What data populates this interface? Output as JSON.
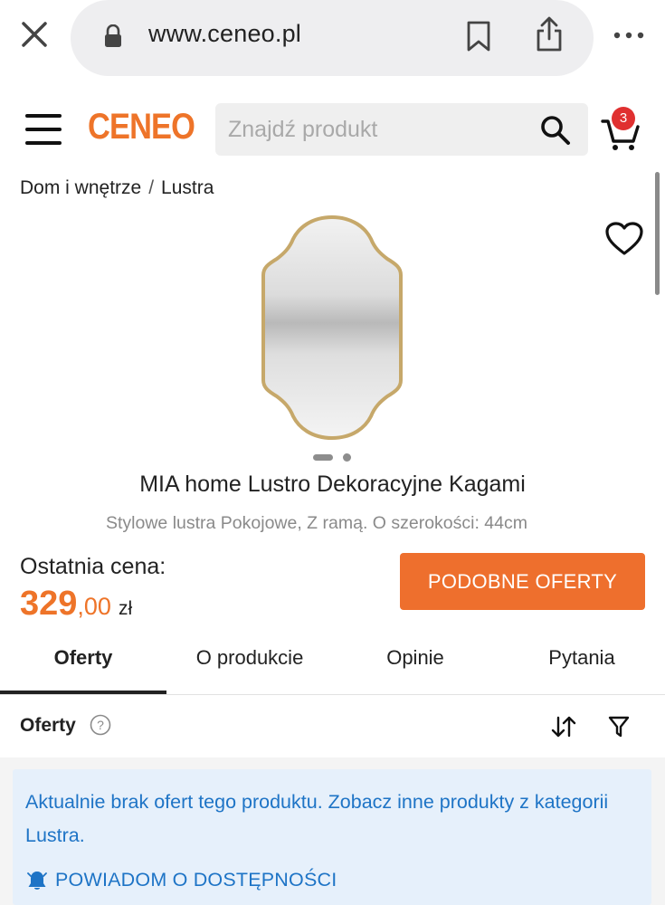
{
  "browser": {
    "url": "www.ceneo.pl",
    "icons": [
      "close-icon",
      "lock-icon",
      "bookmark-icon",
      "share-icon",
      "more-icon"
    ]
  },
  "header": {
    "logo_text": "CENEO",
    "search_placeholder": "Znajdź produkt",
    "cart_count": "3",
    "brand_color": "#ee7429"
  },
  "breadcrumb": {
    "items": [
      "Dom i wnętrze",
      "Lustra"
    ],
    "separator": "/"
  },
  "product": {
    "title": "MIA home Lustro Dekoracyjne Kagami",
    "subtitle": "Stylowe lustra Pokojowe, Z ramą. O szerokości: 44cm",
    "gallery": {
      "current": 1,
      "total": 2
    }
  },
  "price": {
    "label": "Ostatnia cena:",
    "integer": "329",
    "decimal": ",00",
    "currency": "zł"
  },
  "actions": {
    "similar_offers": "PODOBNE OFERTY",
    "button_color": "#ee6f2d"
  },
  "tabs": [
    {
      "label": "Oferty",
      "active": true
    },
    {
      "label": "O produkcie",
      "active": false
    },
    {
      "label": "Opinie",
      "active": false
    },
    {
      "label": "Pytania",
      "active": false
    }
  ],
  "offers": {
    "title": "Oferty",
    "notice": "Aktualnie brak ofert tego produktu. Zobacz inne produkty z kategorii Lustra.",
    "notify_label": "POWIADOM O DOSTĘPNOŚCI",
    "link_color": "#1e74c6"
  }
}
